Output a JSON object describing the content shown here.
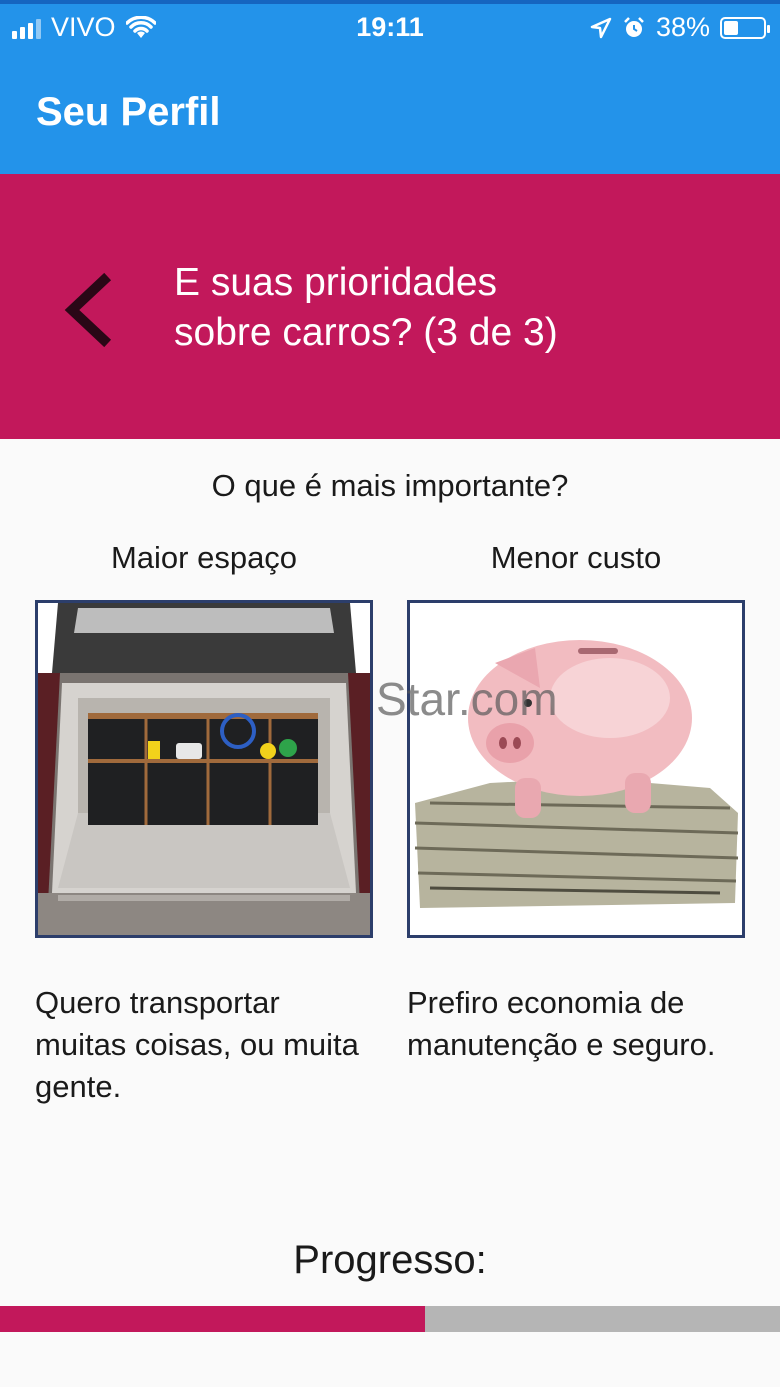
{
  "status_bar": {
    "carrier": "VIVO",
    "time": "19:11",
    "battery_percent": "38%",
    "battery_level": 0.38,
    "icons": [
      "signal-icon",
      "wifi-icon",
      "location-arrow-icon",
      "alarm-icon",
      "battery-icon"
    ]
  },
  "app_bar": {
    "title": "Seu Perfil"
  },
  "banner": {
    "title_line1": "E suas prioridades",
    "title_line2": "sobre carros? (3 de 3)",
    "back_icon": "chevron-left-icon"
  },
  "question": {
    "prompt": "O que é mais importante?"
  },
  "options": [
    {
      "label": "Maior espaço",
      "image": "car-trunk-image",
      "description": "Quero transportar muitas coisas, ou muita gente."
    },
    {
      "label": "Menor custo",
      "image": "piggy-bank-image",
      "description": "Prefiro economia de manutenção e seguro."
    }
  ],
  "watermark": "Star.com",
  "progress": {
    "label": "Progresso:",
    "value": 0.545
  },
  "colors": {
    "app_bar": "#2393ea",
    "banner": "#c2185b",
    "progress_fill": "#c2185b",
    "progress_track": "#b5b5b5",
    "image_border": "#2c3e6b"
  }
}
